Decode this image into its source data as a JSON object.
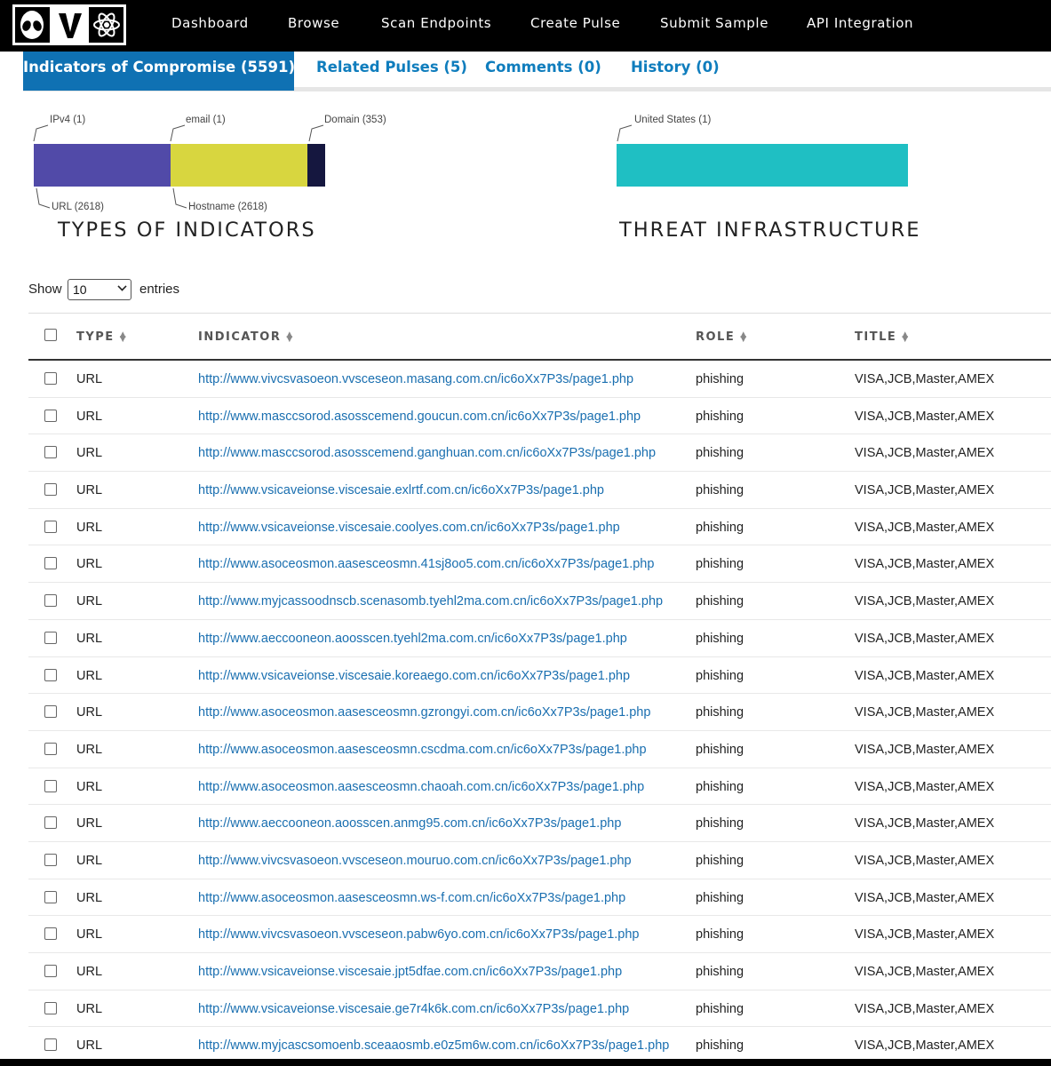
{
  "nav": {
    "logo": "OV",
    "links": [
      "Dashboard",
      "Browse",
      "Scan Endpoints",
      "Create Pulse",
      "Submit Sample",
      "API Integration"
    ]
  },
  "tabs": [
    {
      "label": "Indicators of Compromise (5591)",
      "active": true
    },
    {
      "label": "Related Pulses (5)",
      "active": false
    },
    {
      "label": "Comments (0)",
      "active": false
    },
    {
      "label": "History (0)",
      "active": false
    }
  ],
  "indicator_types": {
    "title": "TYPES OF INDICATORS",
    "labels": {
      "ipv4": "IPv4 (1)",
      "email": "email (1)",
      "domain": "Domain (353)",
      "url": "URL (2618)",
      "hostname": "Hostname (2618)"
    },
    "colors": {
      "url": "#514aa8",
      "hostname": "#d8d63f",
      "domain": "#15173f"
    }
  },
  "threat_infrastructure": {
    "title": "THREAT INFRASTRUCTURE",
    "labels": {
      "us": "United States (1)"
    },
    "colors": {
      "us": "#1fbfc3"
    }
  },
  "length_control": {
    "show": "Show",
    "value": "10",
    "entries": "entries"
  },
  "table": {
    "headers": {
      "type": "TYPE",
      "indicator": "INDICATOR",
      "role": "ROLE",
      "title": "TITLE"
    },
    "rows": [
      {
        "type": "URL",
        "indicator": "http://www.vivcsvasoeon.vvsceseon.masang.com.cn/ic6oXx7P3s/page1.php",
        "role": "phishing",
        "title": "VISA,JCB,Master,AMEX"
      },
      {
        "type": "URL",
        "indicator": "http://www.masccsorod.asosscemend.goucun.com.cn/ic6oXx7P3s/page1.php",
        "role": "phishing",
        "title": "VISA,JCB,Master,AMEX"
      },
      {
        "type": "URL",
        "indicator": "http://www.masccsorod.asosscemend.ganghuan.com.cn/ic6oXx7P3s/page1.php",
        "role": "phishing",
        "title": "VISA,JCB,Master,AMEX"
      },
      {
        "type": "URL",
        "indicator": "http://www.vsicaveionse.viscesaie.exlrtf.com.cn/ic6oXx7P3s/page1.php",
        "role": "phishing",
        "title": "VISA,JCB,Master,AMEX"
      },
      {
        "type": "URL",
        "indicator": "http://www.vsicaveionse.viscesaie.coolyes.com.cn/ic6oXx7P3s/page1.php",
        "role": "phishing",
        "title": "VISA,JCB,Master,AMEX"
      },
      {
        "type": "URL",
        "indicator": "http://www.asoceosmon.aasesceosmn.41sj8oo5.com.cn/ic6oXx7P3s/page1.php",
        "role": "phishing",
        "title": "VISA,JCB,Master,AMEX"
      },
      {
        "type": "URL",
        "indicator": "http://www.myjcassoodnscb.scenasomb.tyehl2ma.com.cn/ic6oXx7P3s/page1.php",
        "role": "phishing",
        "title": "VISA,JCB,Master,AMEX"
      },
      {
        "type": "URL",
        "indicator": "http://www.aeccooneon.aoosscen.tyehl2ma.com.cn/ic6oXx7P3s/page1.php",
        "role": "phishing",
        "title": "VISA,JCB,Master,AMEX"
      },
      {
        "type": "URL",
        "indicator": "http://www.vsicaveionse.viscesaie.koreaego.com.cn/ic6oXx7P3s/page1.php",
        "role": "phishing",
        "title": "VISA,JCB,Master,AMEX"
      },
      {
        "type": "URL",
        "indicator": "http://www.asoceosmon.aasesceosmn.gzrongyi.com.cn/ic6oXx7P3s/page1.php",
        "role": "phishing",
        "title": "VISA,JCB,Master,AMEX"
      },
      {
        "type": "URL",
        "indicator": "http://www.asoceosmon.aasesceosmn.cscdma.com.cn/ic6oXx7P3s/page1.php",
        "role": "phishing",
        "title": "VISA,JCB,Master,AMEX"
      },
      {
        "type": "URL",
        "indicator": "http://www.asoceosmon.aasesceosmn.chaoah.com.cn/ic6oXx7P3s/page1.php",
        "role": "phishing",
        "title": "VISA,JCB,Master,AMEX"
      },
      {
        "type": "URL",
        "indicator": "http://www.aeccooneon.aoosscen.anmg95.com.cn/ic6oXx7P3s/page1.php",
        "role": "phishing",
        "title": "VISA,JCB,Master,AMEX"
      },
      {
        "type": "URL",
        "indicator": "http://www.vivcsvasoeon.vvsceseon.mouruo.com.cn/ic6oXx7P3s/page1.php",
        "role": "phishing",
        "title": "VISA,JCB,Master,AMEX"
      },
      {
        "type": "URL",
        "indicator": "http://www.asoceosmon.aasesceosmn.ws-f.com.cn/ic6oXx7P3s/page1.php",
        "role": "phishing",
        "title": "VISA,JCB,Master,AMEX"
      },
      {
        "type": "URL",
        "indicator": "http://www.vivcsvasoeon.vvsceseon.pabw6yo.com.cn/ic6oXx7P3s/page1.php",
        "role": "phishing",
        "title": "VISA,JCB,Master,AMEX"
      },
      {
        "type": "URL",
        "indicator": "http://www.vsicaveionse.viscesaie.jpt5dfae.com.cn/ic6oXx7P3s/page1.php",
        "role": "phishing",
        "title": "VISA,JCB,Master,AMEX"
      },
      {
        "type": "URL",
        "indicator": "http://www.vsicaveionse.viscesaie.ge7r4k6k.com.cn/ic6oXx7P3s/page1.php",
        "role": "phishing",
        "title": "VISA,JCB,Master,AMEX"
      },
      {
        "type": "URL",
        "indicator": "http://www.myjcascsomoenb.sceaaosmb.e0z5m6w.com.cn/ic6oXx7P3s/page1.php",
        "role": "phishing",
        "title": "VISA,JCB,Master,AMEX"
      }
    ]
  }
}
